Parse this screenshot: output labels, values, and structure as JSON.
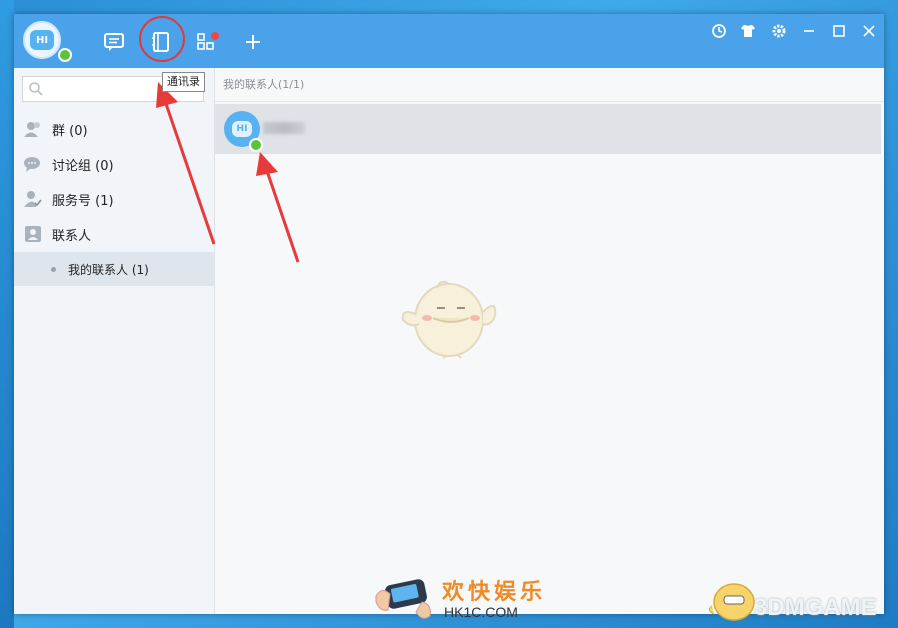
{
  "titlebar": {
    "avatar_text": "HI",
    "tooltip": "通讯录"
  },
  "search": {
    "placeholder": ""
  },
  "sidebar": {
    "items": [
      {
        "label": "群 (0)"
      },
      {
        "label": "讨论组 (0)"
      },
      {
        "label": "服务号 (1)"
      },
      {
        "label": "联系人"
      }
    ],
    "sub_item": {
      "label": "我的联系人 (1)"
    }
  },
  "main": {
    "header": "我的联系人(1/1)",
    "contact": {
      "avatar_text": "HI"
    }
  },
  "watermarks": {
    "left_title": "欢快娱乐",
    "left_sub": "HK1C.COM",
    "right": "3DMGAME"
  },
  "colors": {
    "titlebar": "#4aa3ea",
    "annotation_red": "#e0393b",
    "online_green": "#5cc23a"
  }
}
